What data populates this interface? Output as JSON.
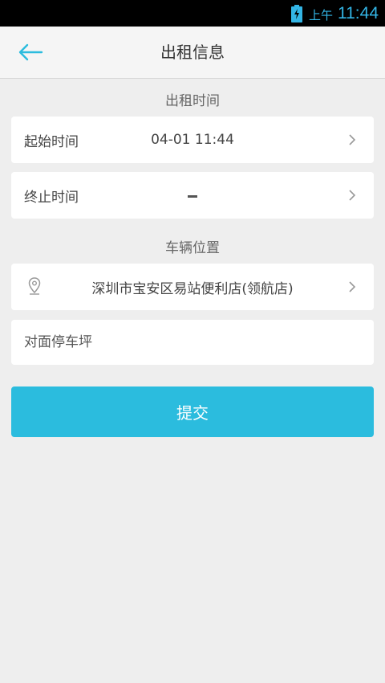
{
  "status_bar": {
    "ampm": "上午",
    "time": "11:44",
    "icons": {
      "battery": "battery-charging-icon"
    },
    "color": "#33b5e5"
  },
  "header": {
    "title": "出租信息",
    "back_icon": "back-arrow-icon",
    "accent_color": "#2bbcde"
  },
  "rental_time": {
    "section_title": "出租时间",
    "start": {
      "label": "起始时间",
      "value": "04-01 11:44"
    },
    "end": {
      "label": "终止时间",
      "value": ""
    }
  },
  "vehicle_location": {
    "section_title": "车辆位置",
    "address": "深圳市宝安区易站便利店(领航店)",
    "address_icon": "location-pin-icon",
    "parking_placeholder": "对面停车坪"
  },
  "actions": {
    "submit_label": "提交",
    "submit_color": "#2bbcde"
  }
}
